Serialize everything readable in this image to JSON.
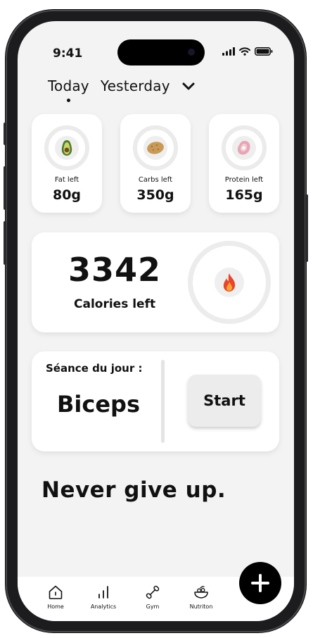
{
  "status": {
    "time": "9:41"
  },
  "tabs": [
    {
      "label": "Today",
      "active": true
    },
    {
      "label": "Yesterday",
      "active": false
    }
  ],
  "macros": [
    {
      "label": "Fat left",
      "value": "80g",
      "icon": "avocado-icon"
    },
    {
      "label": "Carbs left",
      "value": "350g",
      "icon": "potato-icon"
    },
    {
      "label": "Protein left",
      "value": "165g",
      "icon": "meat-icon"
    }
  ],
  "calories": {
    "value": "3342",
    "label": "Calories left",
    "icon": "flame-icon"
  },
  "session": {
    "label": "Séance du jour :",
    "name": "Biceps",
    "start_label": "Start"
  },
  "motto": "Never give up.",
  "nav": [
    {
      "label": "Home",
      "icon": "home-icon"
    },
    {
      "label": "Analytics",
      "icon": "analytics-icon"
    },
    {
      "label": "Gym",
      "icon": "dumbbell-icon"
    },
    {
      "label": "Nutriton",
      "icon": "salad-bowl-icon"
    }
  ],
  "fab": {
    "icon": "plus-icon"
  },
  "colors": {
    "background": "#f3f3f3",
    "card": "#ffffff",
    "accent": "#000000",
    "flame": "#e8452a"
  }
}
